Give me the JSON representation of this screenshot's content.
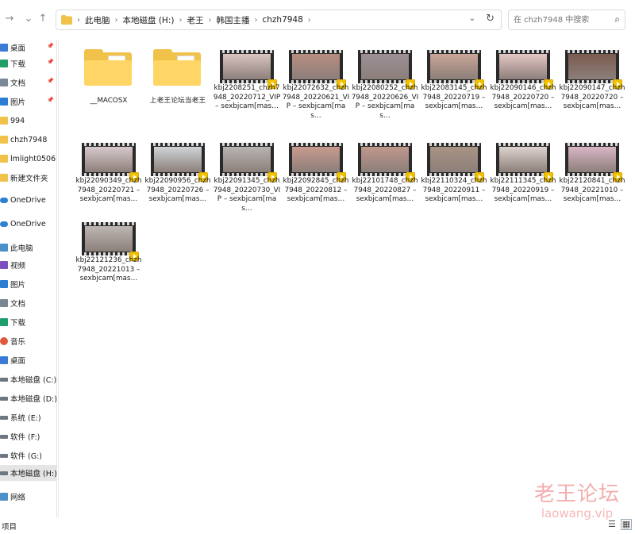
{
  "address": {
    "crumbs": [
      "此电脑",
      "本地磁盘 (H:)",
      "老王",
      "韩国主播",
      "chzh7948"
    ]
  },
  "search": {
    "placeholder": "在 chzh7948 中搜索"
  },
  "sidebar": {
    "items": [
      {
        "label": "桌面",
        "icon": "desktop-icon",
        "pinned": true,
        "color": "#3a7bd5"
      },
      {
        "label": "下载",
        "icon": "download-icon",
        "pinned": true,
        "color": "#1e9e6b"
      },
      {
        "label": "文档",
        "icon": "documents-icon",
        "pinned": true,
        "color": "#7a8794"
      },
      {
        "label": "图片",
        "icon": "pictures-icon",
        "pinned": true,
        "color": "#2d7dd2"
      },
      {
        "label": "994",
        "icon": "folder-icon",
        "pinned": false,
        "color": "#f0c24a"
      },
      {
        "label": "chzh7948",
        "icon": "folder-icon",
        "pinned": false,
        "color": "#f0c24a"
      },
      {
        "label": "lmlight0506",
        "icon": "folder-icon",
        "pinned": false,
        "color": "#f0c24a"
      },
      {
        "label": "新建文件夹",
        "icon": "folder-icon",
        "pinned": false,
        "color": "#f0c24a"
      },
      {
        "label": "OneDrive",
        "icon": "cloud-icon",
        "pinned": false,
        "color": "#2f80d1"
      },
      {
        "label": "OneDrive",
        "icon": "cloud-icon",
        "pinned": false,
        "color": "#2f80d1"
      },
      {
        "label": "此电脑",
        "icon": "computer-icon",
        "pinned": false,
        "color": "#4a90c9"
      },
      {
        "label": "视频",
        "icon": "videos-icon",
        "pinned": false,
        "color": "#7b4fc2"
      },
      {
        "label": "图片",
        "icon": "pictures-icon",
        "pinned": false,
        "color": "#2d7dd2"
      },
      {
        "label": "文档",
        "icon": "documents-icon",
        "pinned": false,
        "color": "#7a8794"
      },
      {
        "label": "下载",
        "icon": "download-icon",
        "pinned": false,
        "color": "#1e9e6b"
      },
      {
        "label": "音乐",
        "icon": "music-icon",
        "pinned": false,
        "color": "#e0583d"
      },
      {
        "label": "桌面",
        "icon": "desktop-icon",
        "pinned": false,
        "color": "#3a7bd5"
      },
      {
        "label": "本地磁盘 (C:)",
        "icon": "drive-icon",
        "pinned": false,
        "color": "#6e7680"
      },
      {
        "label": "本地磁盘 (D:)",
        "icon": "drive-icon",
        "pinned": false,
        "color": "#6e7680"
      },
      {
        "label": "系统 (E:)",
        "icon": "drive-icon",
        "pinned": false,
        "color": "#6e7680"
      },
      {
        "label": "软件 (F:)",
        "icon": "drive-icon",
        "pinned": false,
        "color": "#6e7680"
      },
      {
        "label": "软件 (G:)",
        "icon": "drive-icon",
        "pinned": false,
        "color": "#6e7680"
      },
      {
        "label": "本地磁盘 (H:)",
        "icon": "drive-icon",
        "pinned": false,
        "selected": true,
        "color": "#6e7680"
      },
      {
        "label": "网络",
        "icon": "network-icon",
        "pinned": false,
        "color": "#4a90c9"
      }
    ]
  },
  "files": [
    {
      "name": "__MACOSX",
      "type": "folder"
    },
    {
      "name": "上老王论坛当老王",
      "type": "folder"
    },
    {
      "name": "kbj2208251_chzh7948_20220712_VIP – sexbjcam[mas…",
      "type": "video",
      "tint": "#d9c4c0"
    },
    {
      "name": "kbj22072632_chzh7948_20220621_VIP – sexbjcam[mas…",
      "type": "video",
      "tint": "#b78d80"
    },
    {
      "name": "kbj22080252_chzh7948_20220626_VIP – sexbjcam[mas…",
      "type": "video",
      "tint": "#9c8f96"
    },
    {
      "name": "kbj22083145_chzh7948_20220719 – sexbjcam[mas…",
      "type": "video",
      "tint": "#c9a597"
    },
    {
      "name": "kbj22090146_chzh7948_20220720 – sexbjcam[mas…",
      "type": "video",
      "tint": "#e3c6c4"
    },
    {
      "name": "kbj22090147_chzh7948_20220720 – sexbjcam[mas…",
      "type": "video",
      "tint": "#7b5b50"
    },
    {
      "name": "kbj22090349_chzh7948_20220721 – sexbjcam[mas…",
      "type": "video",
      "tint": "#d7c9cc"
    },
    {
      "name": "kbj22090956_chzh7948_20220726 – sexbjcam[mas…",
      "type": "video",
      "tint": "#cfd4d8"
    },
    {
      "name": "kbj22091345_chzh7948_20220730_VIP – sexbjcam[mas…",
      "type": "video",
      "tint": "#b8b4b2"
    },
    {
      "name": "kbj22092845_chzh7948_20220812 – sexbjcam[mas…",
      "type": "video",
      "tint": "#c89a8e"
    },
    {
      "name": "kbj22101748_chzh7948_20220827 – sexbjcam[mas…",
      "type": "video",
      "tint": "#c0988c"
    },
    {
      "name": "kbj22110324_chzh7948_20220911 – sexbjcam[mas…",
      "type": "video",
      "tint": "#a89484"
    },
    {
      "name": "kbj22111345_chzh7948_20220919 – sexbjcam[mas…",
      "type": "video",
      "tint": "#ddd3cf"
    },
    {
      "name": "kbj22120841_chzh7948_20221010 – sexbjcam[mas…",
      "type": "video",
      "tint": "#d8b6c6"
    },
    {
      "name": "kbj22121236_chzh7948_20221013 – sexbjcam[mas…",
      "type": "video",
      "tint": "#bdb7b3"
    }
  ],
  "status": {
    "count_text": "项目"
  },
  "watermark": {
    "line1": "老王论坛",
    "line2": "laowang.vip"
  }
}
